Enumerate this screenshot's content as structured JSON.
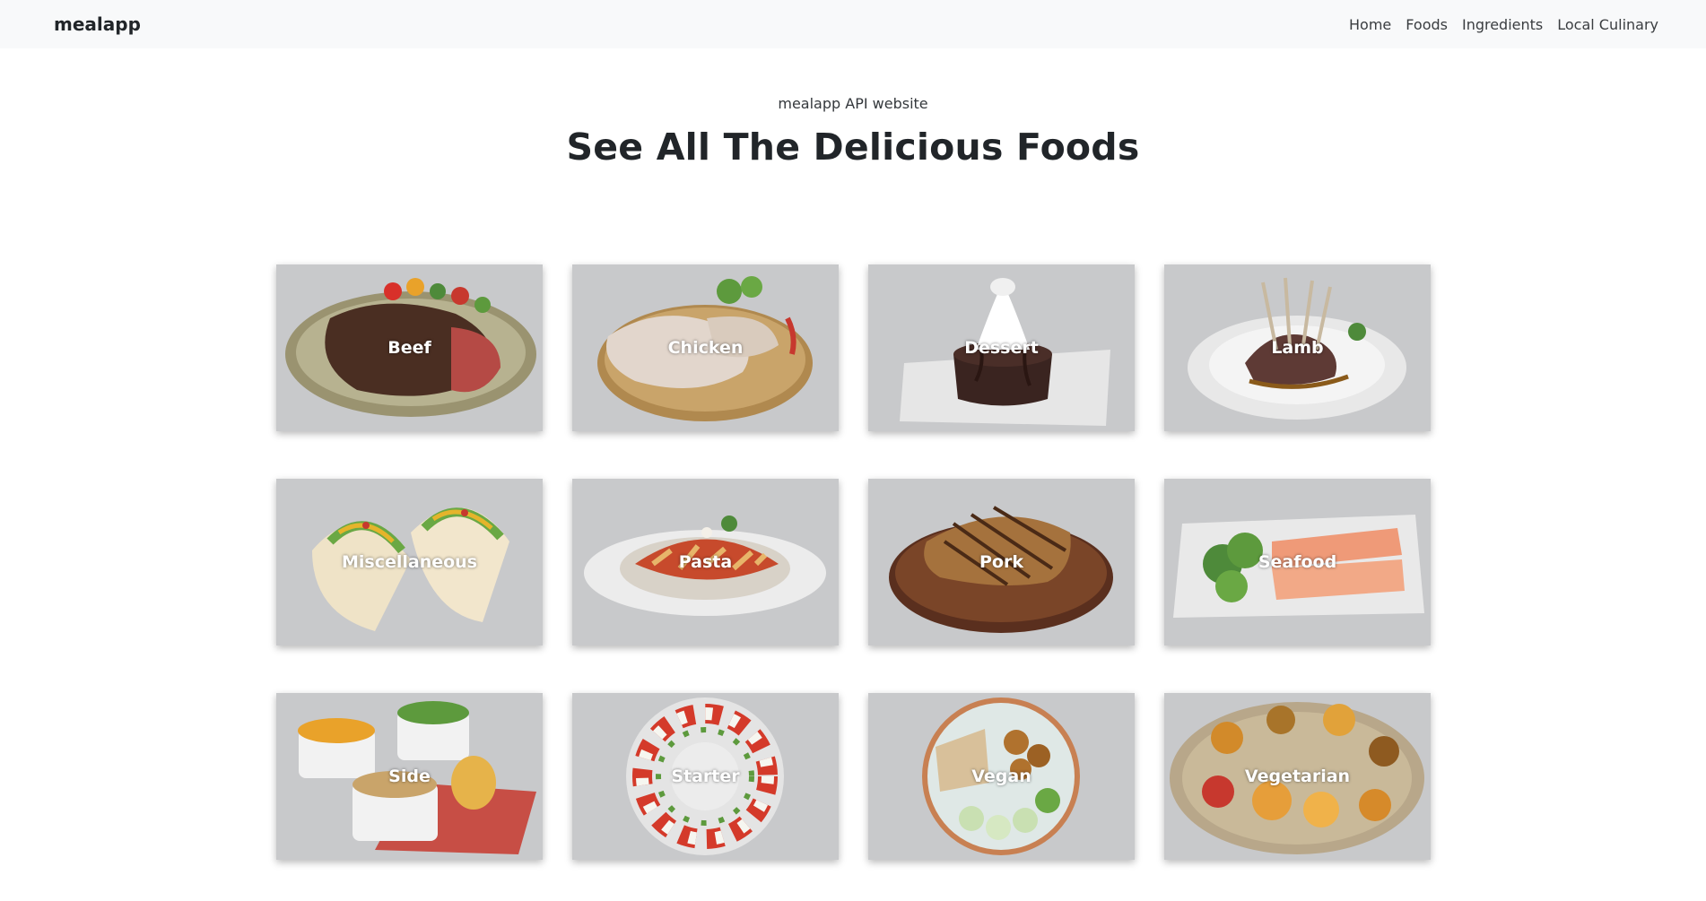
{
  "nav": {
    "brand": "mealapp",
    "links": [
      "Home",
      "Foods",
      "Ingredients",
      "Local Culinary"
    ]
  },
  "hero": {
    "subtitle": "mealapp API website",
    "title": "See All The Delicious Foods"
  },
  "categories": [
    "Beef",
    "Chicken",
    "Dessert",
    "Lamb",
    "Miscellaneous",
    "Pasta",
    "Pork",
    "Seafood",
    "Side",
    "Starter",
    "Vegan",
    "Vegetarian"
  ]
}
